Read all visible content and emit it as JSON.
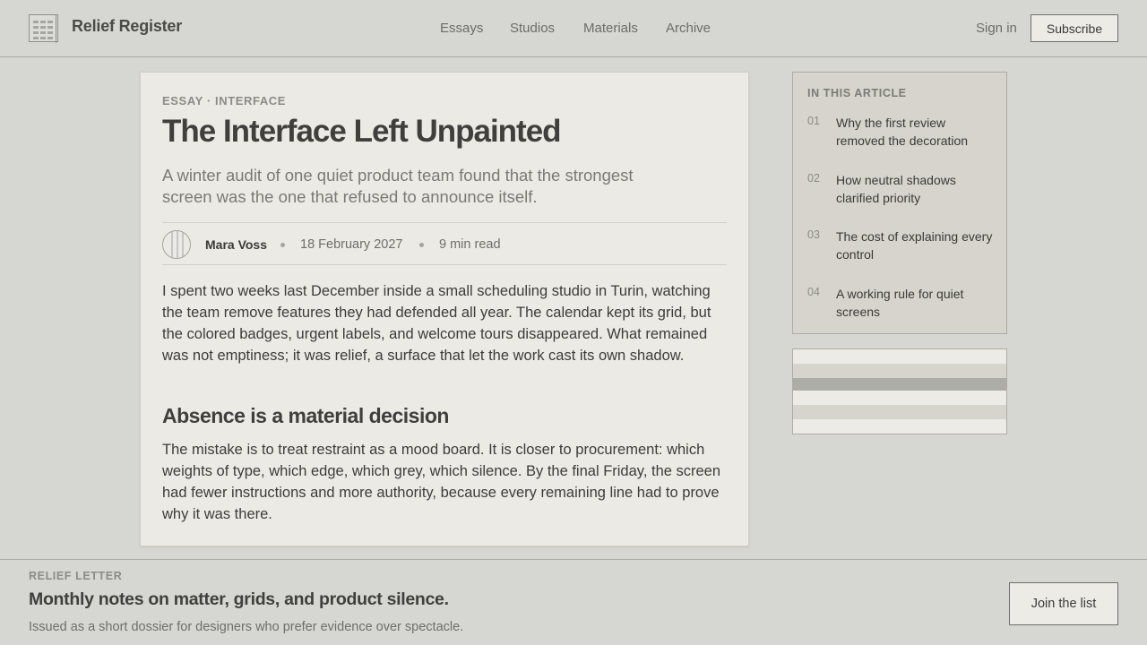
{
  "header": {
    "brand": "Relief Register",
    "logo_icon": "grid-logo-icon",
    "nav": [
      "Essays",
      "Studios",
      "Materials",
      "Archive"
    ],
    "signin": "Sign in",
    "subscribe": "Subscribe"
  },
  "article": {
    "kicker": "ESSAY · INTERFACE",
    "title": "The Interface Left Unpainted",
    "subtitle": "A winter audit of one quiet product team found that the strongest screen was the one that refused to announce itself.",
    "author": "Mara Voss",
    "date": "18 February 2027",
    "read_time": "9 min read",
    "avatar_icon": "avatar-icon",
    "paragraph1": "I spent two weeks last December inside a small scheduling studio in Turin, watching the team remove features they had defended all year. The calendar kept its grid, but the colored badges, urgent labels, and welcome tours disappeared. What remained was not emptiness; it was relief, a surface that let the work cast its own shadow.",
    "heading2": "Absence is a material decision",
    "paragraph2": "The mistake is to treat restraint as a mood board. It is closer to procurement: which weights of type, which edge, which grey, which silence. By the final Friday, the screen had fewer instructions and more authority, because every remaining line had to prove why it was there."
  },
  "toc": {
    "heading": "IN THIS ARTICLE",
    "items": [
      {
        "num": "01",
        "text": "Why the first review removed the decoration"
      },
      {
        "num": "02",
        "text": "How neutral shadows clarified priority"
      },
      {
        "num": "03",
        "text": "The cost of explaining every control"
      },
      {
        "num": "04",
        "text": "A working rule for quiet screens"
      }
    ]
  },
  "swatches": [
    "#ecebe6",
    "#d6d4cc",
    "#adada8",
    "#ecebe6",
    "#d6d4cc",
    "#ecebe6"
  ],
  "footer": {
    "kicker": "RELIEF LETTER",
    "title": "Monthly notes on matter, grids, and product silence.",
    "subtitle": "Issued as a short dossier for designers who prefer evidence over spectacle.",
    "join": "Join the list"
  }
}
